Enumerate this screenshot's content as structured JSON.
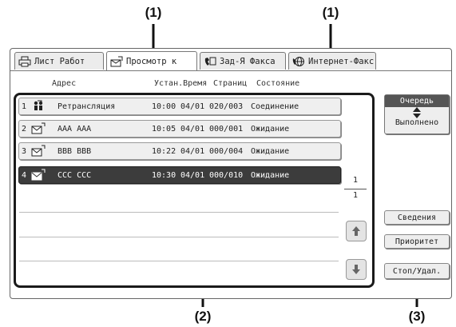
{
  "callouts": {
    "left_tab": "(1)",
    "right_tab": "(1)",
    "list": "(2)",
    "buttons": "(3)"
  },
  "tabs": [
    {
      "label": "Лист Работ",
      "icon": "printer-icon"
    },
    {
      "label": "Просмотр к",
      "icon": "scan-icon"
    },
    {
      "label": "Зад-Я Факса",
      "icon": "fax-icon"
    },
    {
      "label": "Интернет-Факс",
      "icon": "internet-fax-icon"
    }
  ],
  "columns": {
    "address": "Адрес",
    "time": "Устан.Время",
    "pages": "Страниц",
    "status": "Состояние"
  },
  "jobs": [
    {
      "num": "1",
      "name": "Ретрансляция",
      "time": "10:00",
      "date": "04/01",
      "pages": "020/003",
      "status": "Соединение",
      "icon": "relay-icon",
      "selected": false
    },
    {
      "num": "2",
      "name": "AAA AAA",
      "time": "10:05",
      "date": "04/01",
      "pages": "000/001",
      "status": "Ожидание",
      "icon": "mail-icon",
      "selected": false
    },
    {
      "num": "3",
      "name": "BBB BBB",
      "time": "10:22",
      "date": "04/01",
      "pages": "000/004",
      "status": "Ожидание",
      "icon": "mail-icon",
      "selected": false
    },
    {
      "num": "4",
      "name": "CCC CCC",
      "time": "10:30",
      "date": "04/01",
      "pages": "000/010",
      "status": "Ожидание",
      "icon": "mail-icon",
      "selected": true
    }
  ],
  "pagination": {
    "current": "1",
    "total": "1"
  },
  "side": {
    "queue": "Очередь",
    "done": "Выполнено",
    "details": "Сведения",
    "priority": "Приоритет",
    "stop_delete": "Стоп/Удал."
  }
}
